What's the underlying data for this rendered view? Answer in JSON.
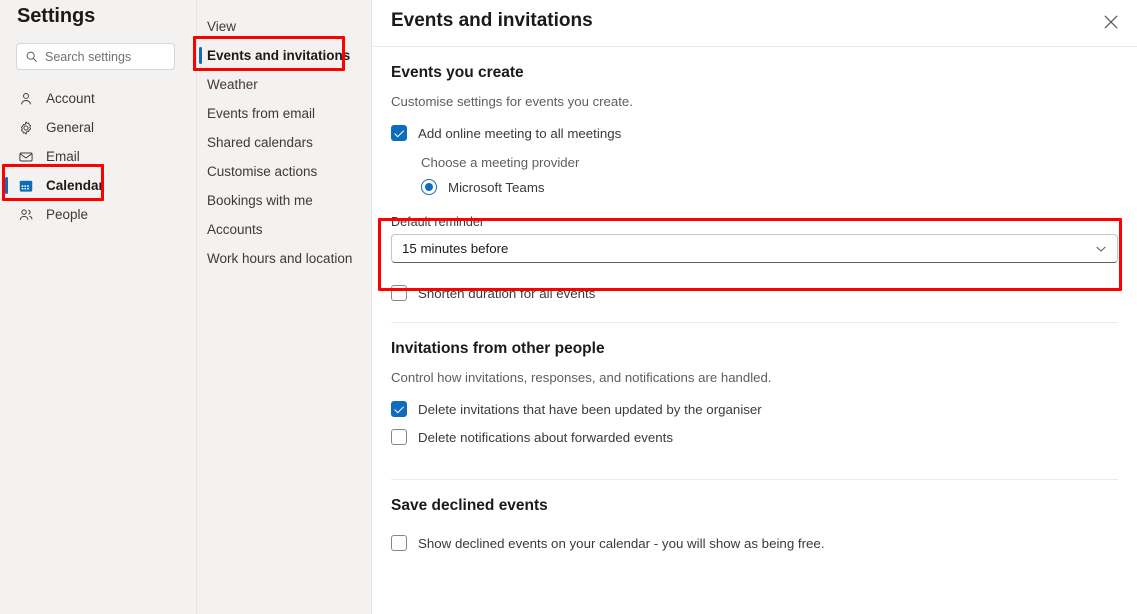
{
  "sidebar": {
    "title": "Settings",
    "search": {
      "placeholder": "Search settings",
      "value": "",
      "icon": "search-icon"
    },
    "items": [
      {
        "label": "Account",
        "icon": "person-icon",
        "selected": false
      },
      {
        "label": "General",
        "icon": "gear-icon",
        "selected": false
      },
      {
        "label": "Email",
        "icon": "envelope-icon",
        "selected": false
      },
      {
        "label": "Calendar",
        "icon": "calendar-icon",
        "selected": true
      },
      {
        "label": "People",
        "icon": "people-icon",
        "selected": false
      }
    ]
  },
  "subnav": {
    "items": [
      {
        "label": "View",
        "selected": false
      },
      {
        "label": "Events and invitations",
        "selected": true
      },
      {
        "label": "Weather",
        "selected": false
      },
      {
        "label": "Events from email",
        "selected": false
      },
      {
        "label": "Shared calendars",
        "selected": false
      },
      {
        "label": "Customise actions",
        "selected": false
      },
      {
        "label": "Bookings with me",
        "selected": false
      },
      {
        "label": "Accounts",
        "selected": false
      },
      {
        "label": "Work hours and location",
        "selected": false
      }
    ]
  },
  "main": {
    "title": "Events and invitations",
    "close_label": "Close",
    "sections": [
      {
        "heading": "Events you create",
        "description": "Customise settings for events you create.",
        "online_meeting": {
          "label": "Add online meeting to all meetings",
          "checked": true
        },
        "provider": {
          "label": "Choose a meeting provider",
          "option_label": "Microsoft Teams",
          "selected": true
        },
        "reminder": {
          "label": "Default reminder",
          "value": "15 minutes before",
          "chevron": "chevron-down-icon"
        },
        "shorten": {
          "label": "Shorten duration for all events",
          "checked": false
        }
      },
      {
        "heading": "Invitations from other people",
        "description": "Control how invitations, responses, and notifications are handled.",
        "checkbox_1": {
          "label": "Delete invitations that have been updated by the organiser",
          "checked": true
        },
        "checkbox_2": {
          "label": "Delete notifications about forwarded events",
          "checked": false
        }
      },
      {
        "heading": "Save declined events",
        "checkbox_1": {
          "label": "Show declined events on your calendar - you will show as being free.",
          "checked": false
        }
      }
    ]
  },
  "annotations": {
    "highlight_color": "#ff0000",
    "boxes": [
      "calendar-sidebar-item",
      "events-and-invitations-nav-item",
      "default-reminder-field"
    ]
  },
  "colors": {
    "accent": "#0f6cbd",
    "panel_bg": "#f3f2f1",
    "content_bg": "#ffffff",
    "text_primary": "#1b1a19",
    "text_secondary": "#605e5c"
  }
}
